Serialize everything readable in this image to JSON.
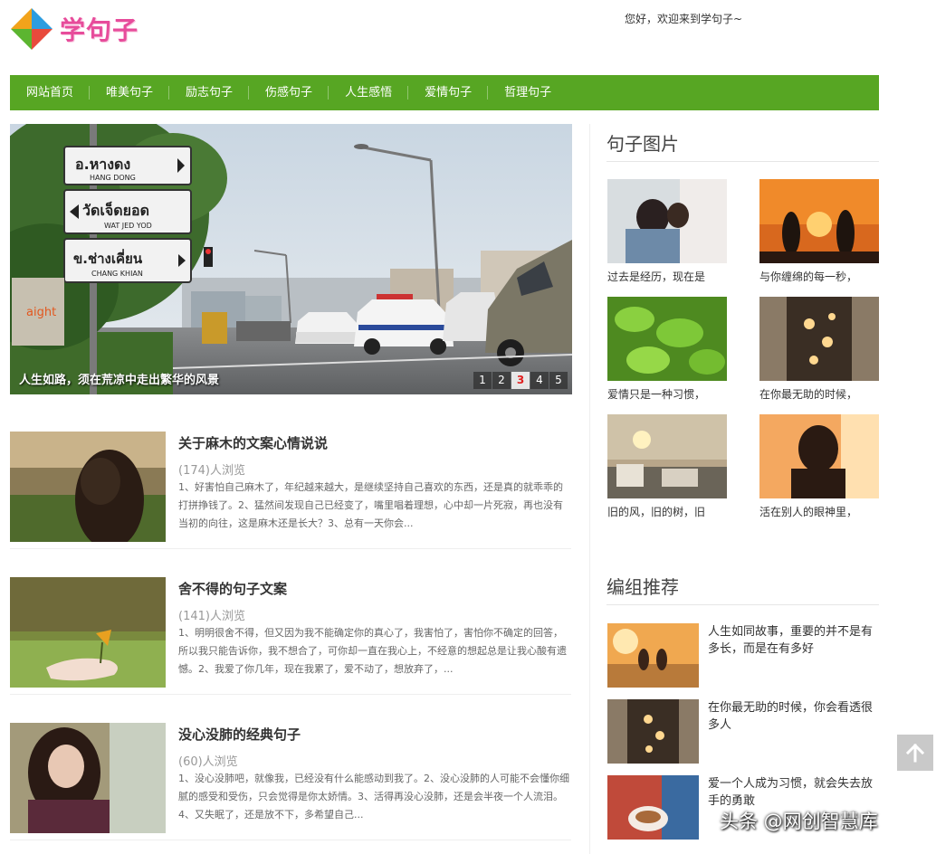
{
  "site": {
    "logo_text": "学句子",
    "welcome": "您好，欢迎来到学句子~"
  },
  "nav": {
    "items": [
      "网站首页",
      "唯美句子",
      "励志句子",
      "伤感句子",
      "人生感悟",
      "爱情句子",
      "哲理句子"
    ]
  },
  "slider": {
    "caption": "人生如路，须在荒凉中走出繁华的风景",
    "pages": [
      "1",
      "2",
      "3",
      "4",
      "5"
    ],
    "active_page": "3",
    "signs": [
      "อ.หางดง",
      "HANG DONG",
      "วัดเจ็ดยอด",
      "WAT JED YOD",
      "ข.ช่างเคี่ยน",
      "CHANG KHIAN"
    ],
    "shop_sign": "aight"
  },
  "articles": [
    {
      "title": "关于麻木的文案心情说说",
      "views": "(174)人浏览",
      "excerpt": "1、好害怕自己麻木了，年纪越来越大，是继续坚持自己喜欢的东西，还是真的就乖乖的打拼挣钱了。2、猛然间发现自己已经变了，嘴里唱着理想，心中却一片死寂，再也没有当初的向往，这是麻木还是长大？3、总有一天你会..."
    },
    {
      "title": "舍不得的句子文案",
      "views": "(141)人浏览",
      "excerpt": "1、明明很舍不得，但又因为我不能确定你的真心了，我害怕了，害怕你不确定的回答，所以我只能告诉你，我不想合了，可你却一直在我心上，不经意的想起总是让我心酸有遗憾。2、我爱了你几年，现在我累了，爱不动了，想放弃了，..."
    },
    {
      "title": "没心没肺的经典句子",
      "views": "(60)人浏览",
      "excerpt": "1、没心没肺吧，就像我，已经没有什么能感动到我了。2、没心没肺的人可能不会懂你细腻的感受和受伤，只会觉得是你太娇情。3、活得再没心没肺，还是会半夜一个人流泪。4、又失眠了，还是放不下，多希望自己..."
    }
  ],
  "sidebar": {
    "pictures_title": "句子图片",
    "pictures": [
      "过去是经历，现在是",
      "与你缠绵的每一秒，",
      "爱情只是一种习惯，",
      "在你最无助的时候，",
      "旧的风，旧的树，旧",
      "活在别人的眼神里，"
    ],
    "recommend_title": "编组推荐",
    "recommend": [
      "人生如同故事，重要的并不是有多长，而是在有多好",
      "在你最无助的时候，你会看透很多人",
      "爱一个人成为习惯，就会失去放手的勇敢"
    ]
  },
  "watermark": "头条 @网创智慧库",
  "colors": {
    "nav_bg": "#57a623",
    "accent_red": "#e02020",
    "logo_pink": "#e74c9b"
  }
}
